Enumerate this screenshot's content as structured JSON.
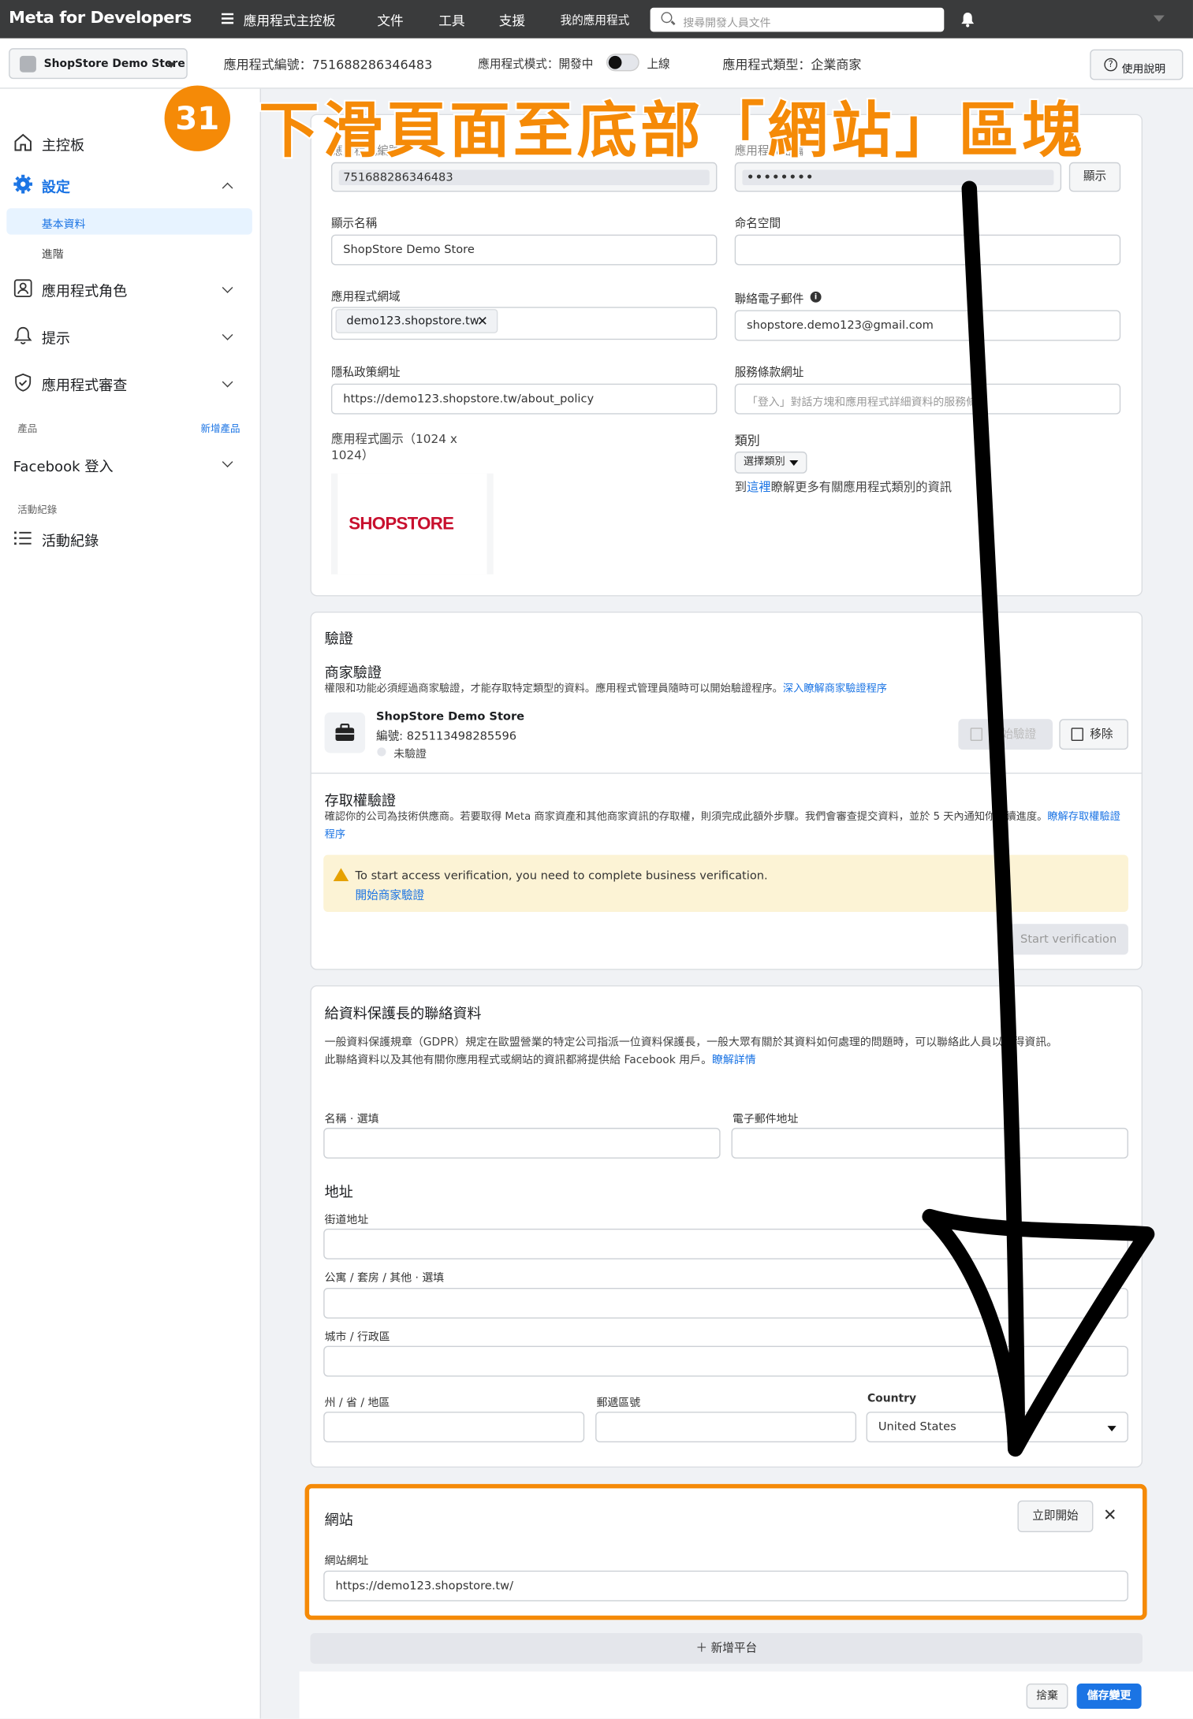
{
  "topbar": {
    "brand": "Meta for Developers",
    "nav_dashboard": "應用程式主控板",
    "nav_docs": "文件",
    "nav_tools": "工具",
    "nav_support": "支援",
    "nav_my_apps": "我的應用程式",
    "search_placeholder": "搜尋開發人員文件"
  },
  "subbar": {
    "app_name": "ShopStore Demo Store",
    "app_id_label": "應用程式編號：751688286346483",
    "mode_label": "應用程式模式：開發中",
    "mode_live": "上線",
    "type_label": "應用程式類型：企業商家",
    "help": "使用說明"
  },
  "sidebar": {
    "dashboard": "主控板",
    "settings": "設定",
    "basic": "基本資料",
    "advanced": "進階",
    "roles": "應用程式角色",
    "alerts": "提示",
    "review": "應用程式審查",
    "products_section": "產品",
    "add_product": "新增產品",
    "fb_login": "Facebook 登入",
    "activity_section": "活動紀錄",
    "activity": "活動紀錄"
  },
  "annotation": {
    "step": "31",
    "text": "下滑頁面至底部「網站」區塊"
  },
  "basic": {
    "app_id_value": "751688286346483",
    "secret_value": "••••••••",
    "show_btn": "顯示",
    "display_name_label": "顯示名稱",
    "display_name_value": "ShopStore Demo Store",
    "namespace_label": "命名空間",
    "domain_label": "應用程式網域",
    "domain_chip": "demo123.shopstore.tw",
    "email_label": "聯絡電子郵件",
    "email_value": "shopstore.demo123@gmail.com",
    "privacy_label": "隱私政策網址",
    "privacy_value": "https://demo123.shopstore.tw/about_policy",
    "tos_label": "服務條款網址",
    "tos_placeholder": "「登入」對話方塊和應用程式詳細資料的服務條款",
    "icon_label": "應用程式圖示（1024 x 1024）",
    "logo_text": "SHOPSTORE",
    "category_label": "類別",
    "category_select": "選擇類別",
    "category_hint_pre": "到",
    "category_hint_link": "這裡",
    "category_hint_post": "瞭解更多有關應用程式類別的資訊"
  },
  "verify": {
    "title": "驗證",
    "biz_title": "商家驗證",
    "biz_desc": "權限和功能必須經過商家驗證，才能存取特定類型的資料。應用程式管理員隨時可以開始驗證程序。",
    "biz_link": "深入瞭解商家驗證程序",
    "biz_name": "ShopStore Demo Store",
    "biz_id": "編號: 825113498285596",
    "biz_status": "未驗證",
    "start_btn": "開始驗證",
    "remove_btn": "移除",
    "access_title": "存取權驗證",
    "access_desc": "確認你的公司為技術供應商。若要取得 Meta 商家資產和其他商家資訊的存取權，則須完成此額外步驟。我們會審查提交資料，並於 5 天內通知你後續進度。",
    "access_link": "瞭解存取權驗證程序",
    "warn_text": "To start access verification, you need to complete business verification.",
    "warn_link": "開始商家驗證",
    "start_access_btn": "Start verification"
  },
  "gdpr": {
    "title": "給資料保護長的聯絡資料",
    "desc1": "一般資料保護規章（GDPR）規定在歐盟營業的特定公司指派一位資料保護長，一般大眾有關於其資料如何處理的問題時，可以聯絡此人員以取得資訊。",
    "desc2": "此聯絡資料以及其他有關你應用程式或網站的資訊都將提供給 Facebook 用戶。",
    "desc_link": "瞭解詳情",
    "name_label": "名稱 · 選填",
    "email_label": "電子郵件地址",
    "address_title": "地址",
    "street_label": "街道地址",
    "apt_label": "公寓 / 套房 / 其他 · 選填",
    "city_label": "城市 / 行政區",
    "state_label": "州 / 省 / 地區",
    "zip_label": "郵遞區號",
    "country_label": "Country",
    "country_value": "United States"
  },
  "website": {
    "title": "網站",
    "quickstart": "立即開始",
    "url_label": "網站網址",
    "url_value": "https://demo123.shopstore.tw/"
  },
  "footer": {
    "add_platform": "＋ 新增平台",
    "discard": "捨棄",
    "save": "儲存變更"
  }
}
